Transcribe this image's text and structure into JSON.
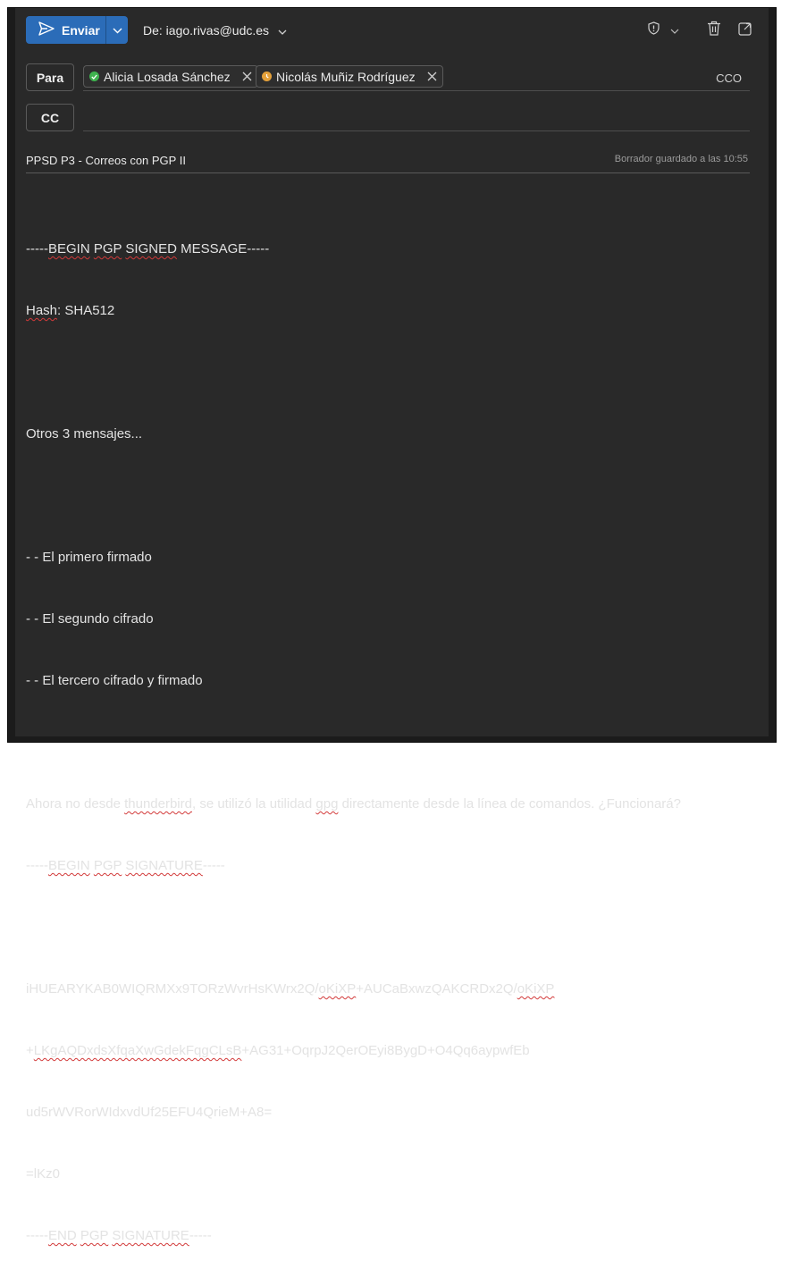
{
  "toolbar": {
    "send_label": "Enviar",
    "from_label": "De: iago.rivas@udc.es",
    "icons": [
      "shield-icon",
      "chevron-down-icon",
      "trash-icon",
      "popout-icon"
    ]
  },
  "recipients": {
    "to_button": "Para",
    "cc_button": "CC",
    "bcc_link": "CCO",
    "to": [
      {
        "name": "Alicia Losada Sánchez",
        "status": "available",
        "status_color": "#3fb34f"
      },
      {
        "name": "Nicolás Muñiz Rodríguez",
        "status": "away",
        "status_color": "#e5a13a"
      }
    ]
  },
  "subject": {
    "text": "PPSD P3 - Correos con PGP II",
    "draft_status": "Borrador guardado a las 10:55"
  },
  "body": {
    "l1a": "-----",
    "l1b": "BEGIN",
    "l1c": " ",
    "l1d": "PGP",
    "l1e": " ",
    "l1f": "SIGNED",
    "l1g": " ",
    "l1h": "MESSAGE",
    "l1i": "-----",
    "l2a": "Hash",
    "l2b": ": SHA512",
    "l4": "Otros 3 mensajes...",
    "l6": "- - El primero firmado",
    "l7": "- - El segundo cifrado",
    "l8": "- - El tercero cifrado y firmado",
    "l10a": "Ahora no desde ",
    "l10b": "thunderbird",
    "l10c": ", se utilizó la utilidad ",
    "l10d": "gpg",
    "l10e": " directamente desde la línea de comandos. ¿Funcionará?",
    "l11a": "-----",
    "l11b": "BEGIN",
    "l11c": " ",
    "l11d": "PGP",
    "l11e": " ",
    "l11f": "SIGNATURE",
    "l11g": "-----",
    "l13a": "iHUEARYKAB0WIQRMXx9TORzWvrHsKWrx2Q/",
    "l13b": "oKiXP",
    "l13c": "+AUCaBxwzQAKCRDx2Q/",
    "l13d": "oKiXP",
    "l14a": "+",
    "l14b": "LKgAQDxdsXfqaXwGdekFqgCLsB",
    "l14c": "+AG31+OqrpJ2QerOEyi8BygD+O4Qq6aypwfEb",
    "l15": "ud5rWVRorWIdxvdUf25EFU4QrieM+A8=",
    "l16": "=lKz0",
    "l17a": "-----",
    "l17b": "END",
    "l17c": " ",
    "l17d": "PGP",
    "l17e": " ",
    "l17f": "SIGNATURE",
    "l17g": "-----"
  }
}
